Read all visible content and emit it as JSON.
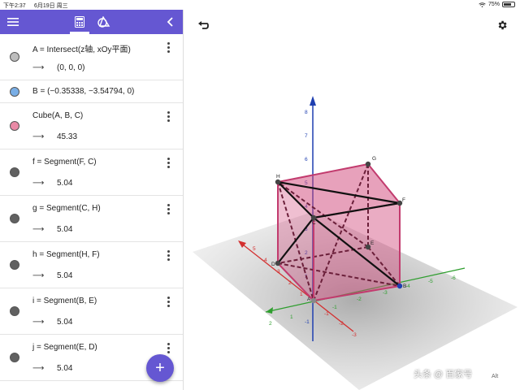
{
  "status": {
    "time": "下午2:37",
    "date": "6月19日 周三",
    "battery": "75%",
    "battery_level": 0.75
  },
  "toolbar": {
    "menu_icon": "hamburger-icon",
    "calc_icon": "calculator-icon",
    "tools_icon": "shapes-icon",
    "collapse_icon": "chevron-left-icon"
  },
  "algebra": [
    {
      "definition": "A = Intersect(z轴, xOy平面)",
      "value": "(0, 0, 0)",
      "dot_color": "#bdbdbd"
    },
    {
      "definition": "B = (−0.35338, −3.54794, 0)",
      "value": "",
      "dot_color": "#79aee6"
    },
    {
      "definition": "Cube(A, B, C)",
      "value": "45.33",
      "dot_color": "#e98aa6"
    },
    {
      "definition": "f = Segment(F, C)",
      "value": "5.04",
      "dot_color": "#616161"
    },
    {
      "definition": "g = Segment(C, H)",
      "value": "5.04",
      "dot_color": "#616161"
    },
    {
      "definition": "h = Segment(H, F)",
      "value": "5.04",
      "dot_color": "#616161"
    },
    {
      "definition": "i = Segment(B, E)",
      "value": "5.04",
      "dot_color": "#616161"
    },
    {
      "definition": "j = Segment(E, D)",
      "value": "5.04",
      "dot_color": "#616161"
    }
  ],
  "arrow_symbol": "⟶",
  "fab_label": "+",
  "graphics": {
    "undo_icon": "undo-icon",
    "settings_icon": "gear-icon",
    "z_ticks": [
      "8",
      "7",
      "6",
      "5",
      "4",
      "3",
      "2",
      "1",
      "-1"
    ],
    "x_ticks": [
      "5",
      "4",
      "3",
      "2",
      "1",
      "-1",
      "-2",
      "-3"
    ],
    "y_ticks": [
      "2",
      "1",
      "-1",
      "-2",
      "-3",
      "-4",
      "-5",
      "-6"
    ],
    "point_labels": [
      "H",
      "G",
      "F",
      "C",
      "B",
      "A",
      "D",
      "E"
    ],
    "watermark": "头条 @ 百家号",
    "corner_tag": "Alt"
  },
  "colors": {
    "accent": "#6557d2",
    "cube_fill": "#d1477a",
    "axis_x": "#d32f2f",
    "axis_y": "#2e9e2e",
    "axis_z": "#1f3fb0"
  }
}
